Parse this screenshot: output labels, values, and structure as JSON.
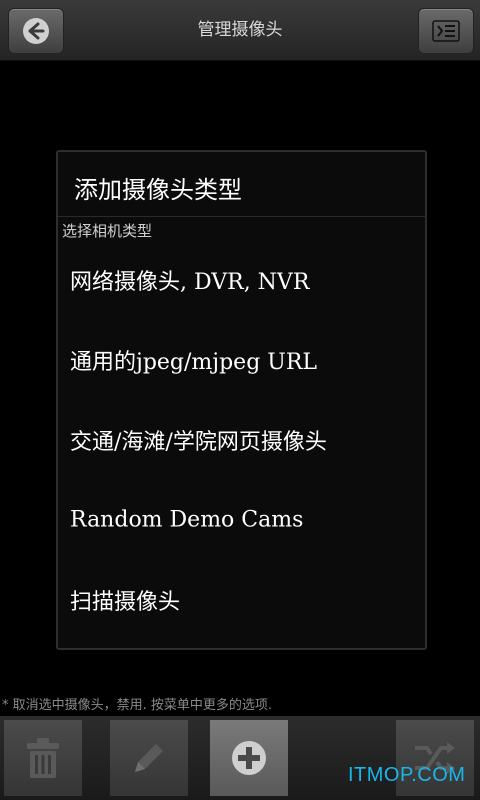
{
  "header": {
    "title": "管理摄像头",
    "back_icon": "back-arrow-icon",
    "menu_icon": "list-menu-icon"
  },
  "dialog": {
    "title": "添加摄像头类型",
    "subtitle": "选择相机类型",
    "options": [
      "网络摄像头, DVR, NVR",
      "通用的jpeg/mjpeg URL",
      "交通/海滩/学院网页摄像头",
      "Random Demo Cams",
      "扫描摄像头"
    ]
  },
  "footnote": "* 取消选中摄像头，禁用. 按菜单中更多的选项.",
  "bottom_bar": {
    "icons": [
      "trash-icon",
      "pencil-icon",
      "add-circle-icon",
      "shuffle-icon"
    ]
  },
  "watermark": "ITMOP.COM",
  "colors": {
    "watermark": "#19b6e8",
    "background": "#000000"
  }
}
